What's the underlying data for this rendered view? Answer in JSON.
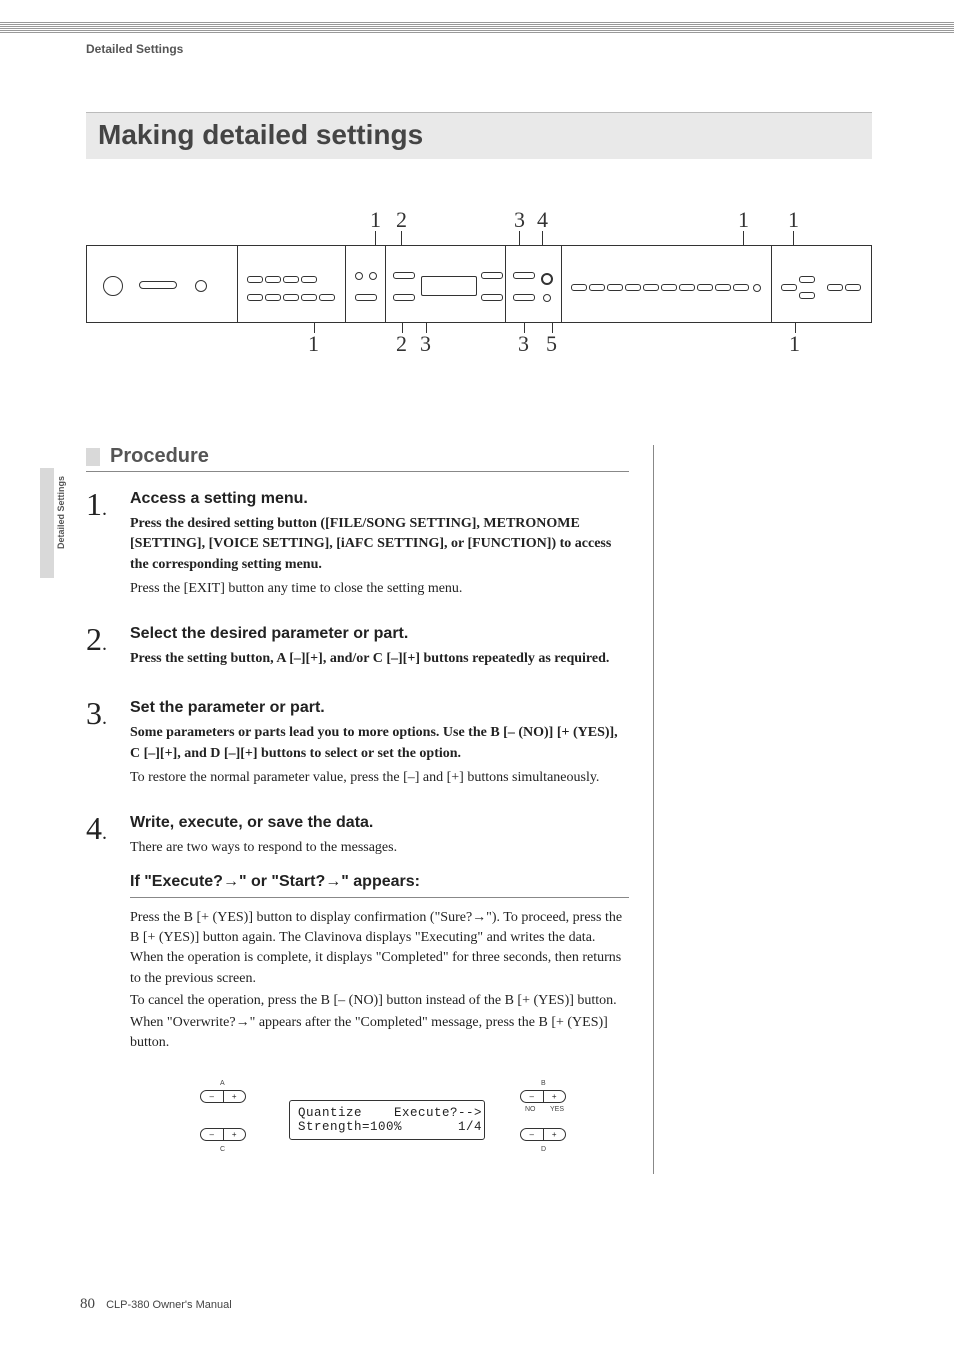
{
  "running_head": "Detailed Settings",
  "side_tab": "Detailed Settings",
  "title": "Making detailed settings",
  "panel": {
    "top_nums": [
      "1",
      "2",
      "3",
      "4",
      "1",
      "1"
    ],
    "bottom_nums": [
      "1",
      "2",
      "3",
      "3",
      "5",
      "1"
    ]
  },
  "procedure": {
    "heading": "Procedure",
    "steps": [
      {
        "n": "1",
        "title": "Access a setting menu.",
        "bold": "Press the desired setting button ([FILE/SONG SETTING], METRONOME [SETTING], [VOICE SETTING], [iAFC SETTING], or [FUNCTION]) to access the corresponding setting menu.",
        "light": "Press the [EXIT] button any time to close the setting menu."
      },
      {
        "n": "2",
        "title": "Select the desired parameter or part.",
        "bold": "Press the setting button, A [–][+], and/or C [–][+] buttons repeatedly as required.",
        "light": ""
      },
      {
        "n": "3",
        "title": "Set the parameter or part.",
        "bold": "Some parameters or parts lead you to more options. Use the B [– (NO)] [+ (YES)], C [–][+], and D [–][+] buttons to select or set the option.",
        "light": "To restore the normal parameter value, press the [–] and [+] buttons simultaneously."
      },
      {
        "n": "4",
        "title": "Write, execute, or save the data.",
        "bold": "",
        "light": "There are two ways to respond to the messages."
      }
    ],
    "sub_heading": "If \"Execute?→\" or \"Start?→\" appears:",
    "para1": "Press the B [+ (YES)] button to display confirmation (\"Sure?→\"). To proceed, press the B [+ (YES)] button again. The Clavinova displays \"Executing\" and writes the data. When the operation is complete, it displays \"Completed\" for three seconds, then returns to the previous screen.",
    "para2": "To cancel the operation, press the B [– (NO)] button instead of the B [+ (YES)] button.",
    "para3": "When \"Overwrite?→\" appears after the \"Completed\" message, press the B [+ (YES)] button."
  },
  "lcd": {
    "line1": "Quantize    Execute?-->",
    "line2": "Strength=100%       1/4",
    "labels": {
      "a": "A",
      "b": "B",
      "c": "C",
      "d": "D",
      "no": "NO",
      "yes": "YES"
    }
  },
  "footer": {
    "page": "80",
    "manual": "CLP-380 Owner's Manual"
  }
}
